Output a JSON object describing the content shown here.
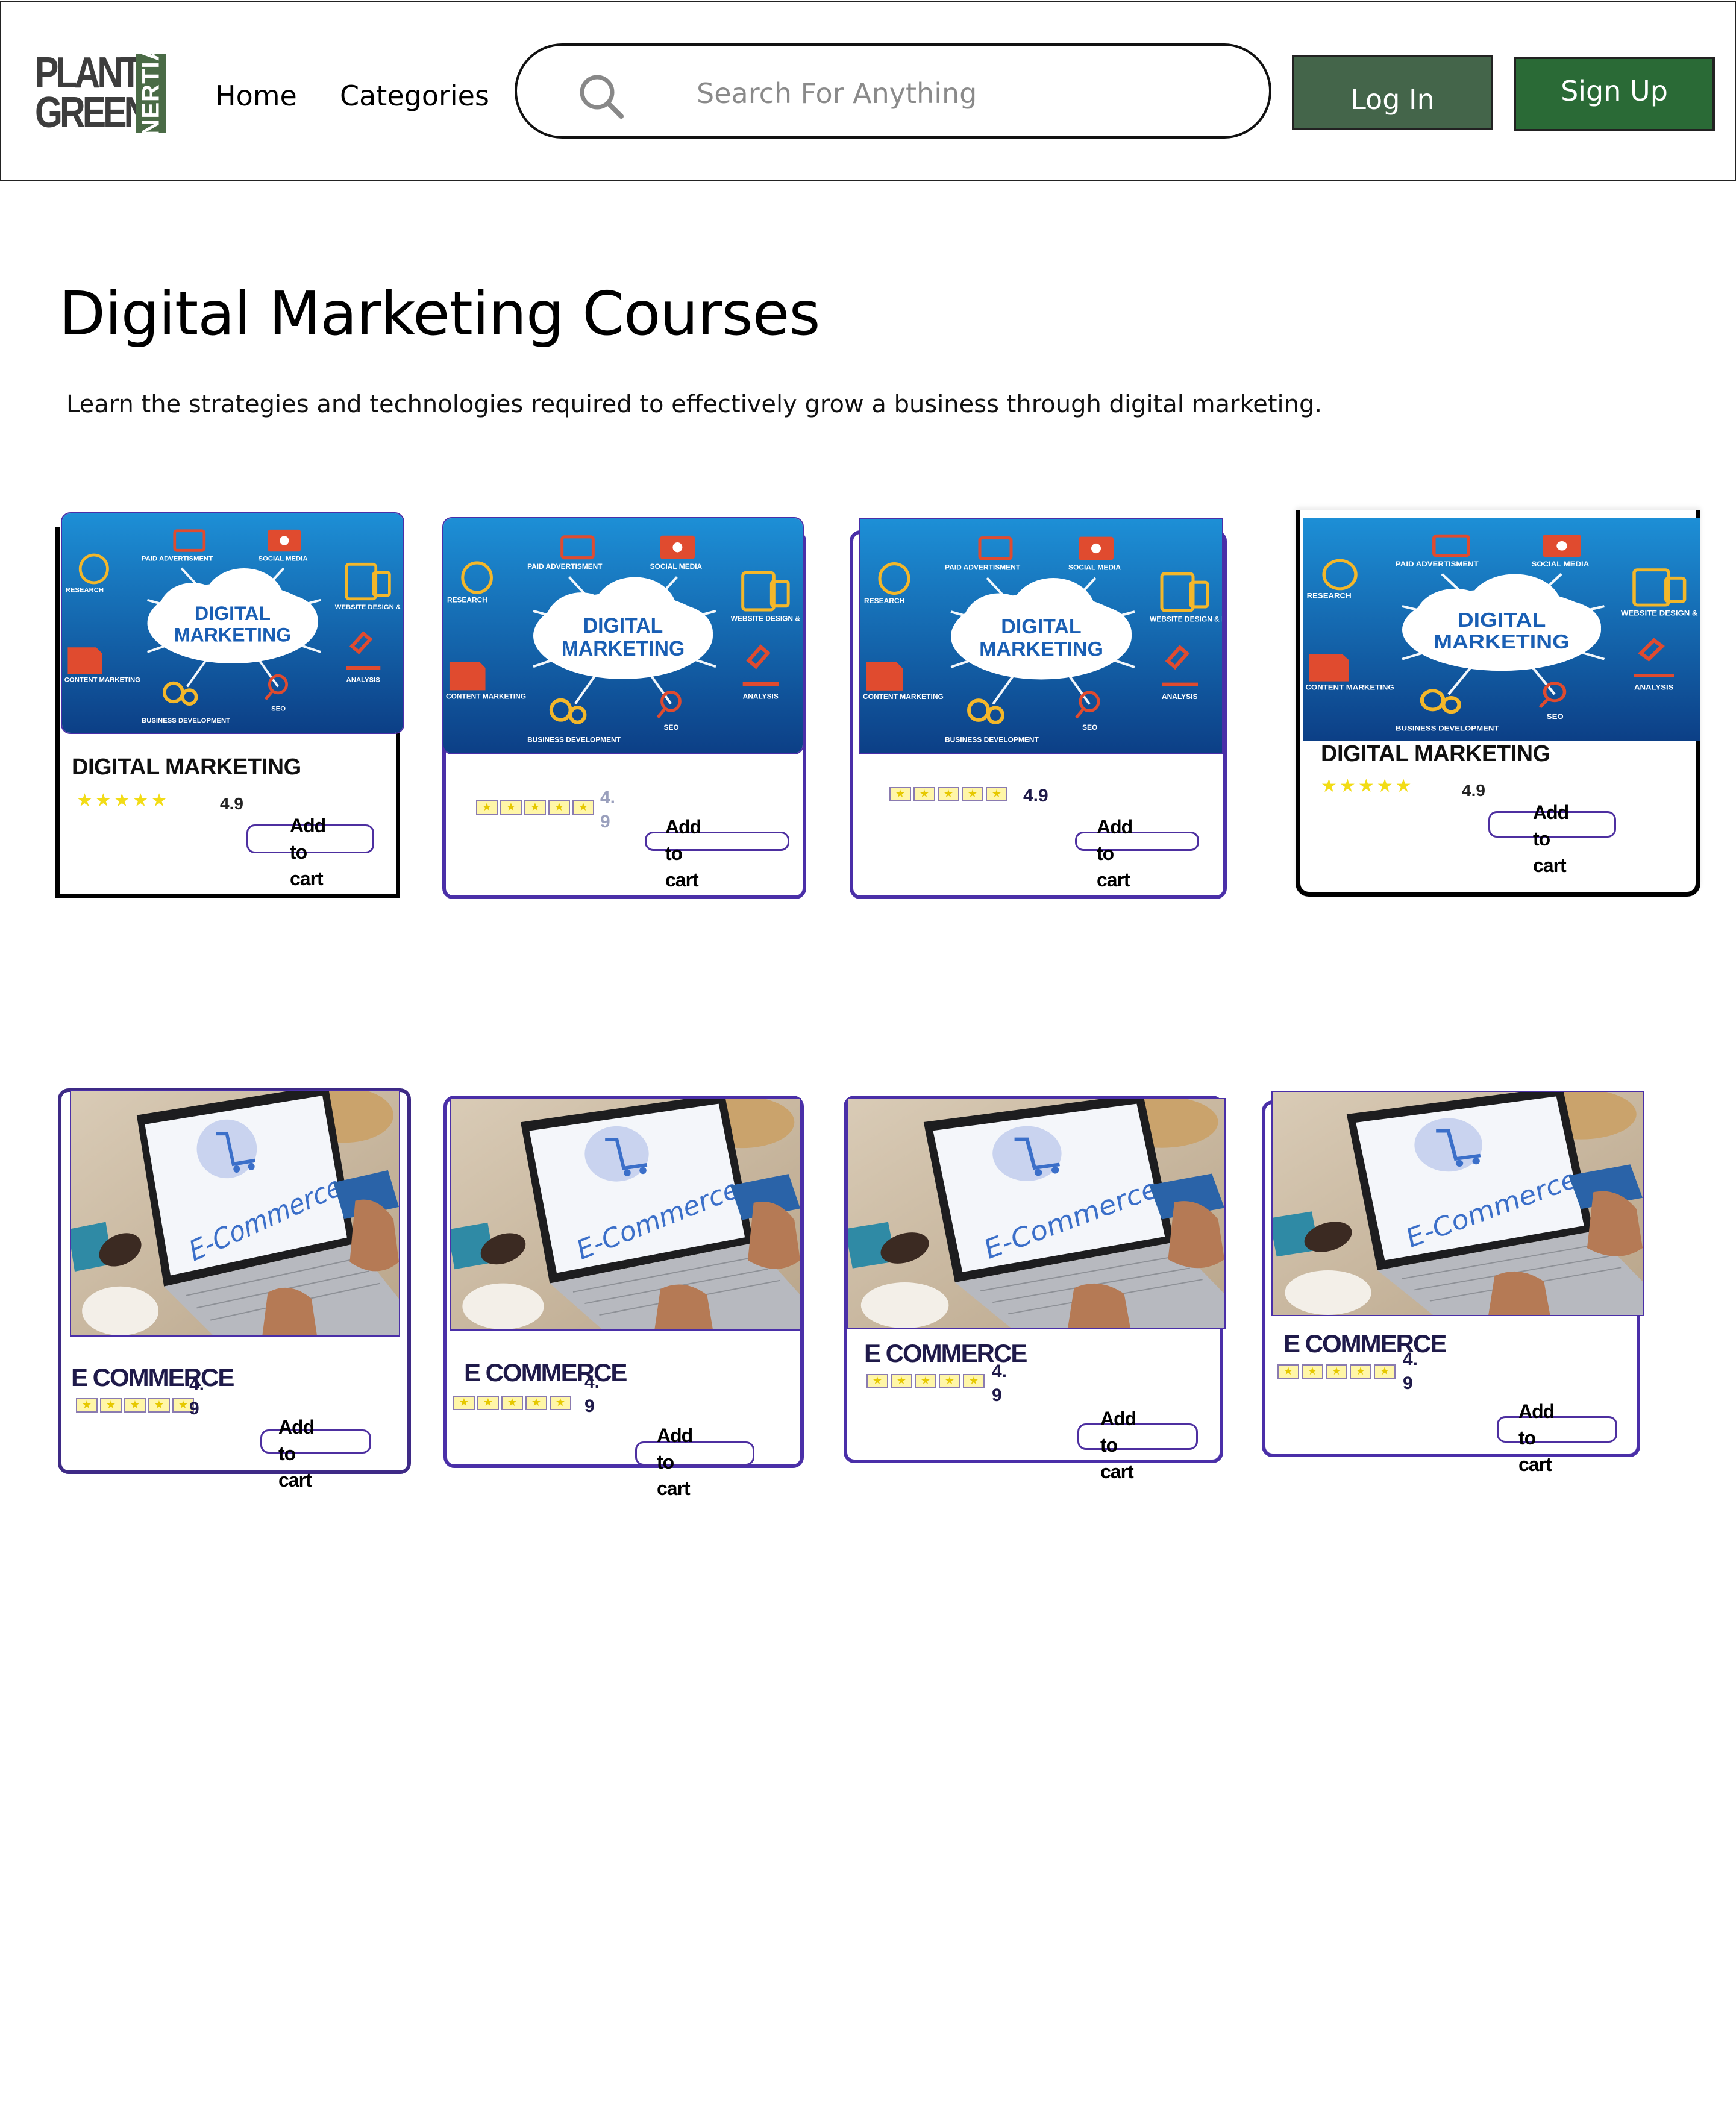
{
  "brand": {
    "logo_line1": "PLANT",
    "logo_line2": "GREEN",
    "logo_vertical": "INERTIA"
  },
  "nav": {
    "home": "Home",
    "categories": "Categories"
  },
  "search": {
    "placeholder": "Search For Anything",
    "icon": "search-icon"
  },
  "auth": {
    "login": "Log In",
    "signup": "Sign Up"
  },
  "page": {
    "title": "Digital Marketing Courses",
    "subtitle": "Learn the strategies and technologies required to effectively grow a business through digital marketing."
  },
  "thumbnail_text": {
    "digital": [
      "DIGITAL",
      "MARKETING"
    ],
    "digital_labels": [
      "PAID ADVERTISMENT",
      "SOCIAL MEDIA",
      "RESEARCH",
      "WEBSITE DESIGN & DEVELOPMENT",
      "CONTENT MARKETING",
      "ANALYSIS",
      "SEO",
      "BUSINESS DEVELOPMENT"
    ],
    "ecommerce": "E-Commerce"
  },
  "courses_row1": [
    {
      "title": "DIGITAL MARKETING",
      "rating": "4.9",
      "cart": "Add to cart"
    },
    {
      "title": "",
      "rating": "4. 9",
      "cart": "Add to cart"
    },
    {
      "title": "",
      "rating": "4.9",
      "cart": "Add to cart"
    },
    {
      "title": "DIGITAL MARKETING",
      "rating": "4.9",
      "cart": "Add to cart"
    }
  ],
  "courses_row2": [
    {
      "title": "E  COMMERCE",
      "rating": "4. 9",
      "cart": "Add to cart"
    },
    {
      "title": "E COMMERCE",
      "rating": "4. 9",
      "cart": "Add to cart"
    },
    {
      "title": "E COMMERCE",
      "rating": "4. 9",
      "cart": "Add to cart"
    },
    {
      "title": "E COMMERCE",
      "rating": "4. 9",
      "cart": "Add to cart"
    }
  ],
  "colors": {
    "login_bg": "#44654a",
    "signup_bg": "#2a6a36",
    "card_border": "#4a2fa8",
    "star": "#f2dc16"
  }
}
